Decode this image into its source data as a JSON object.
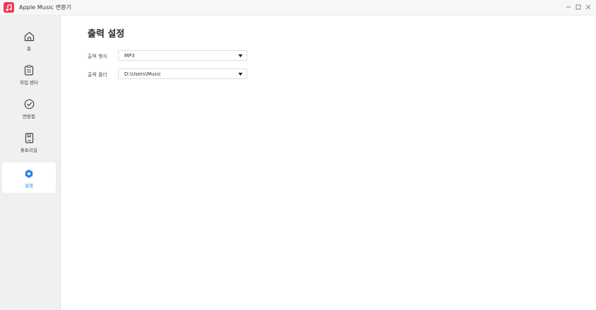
{
  "app": {
    "title": "Apple Music 변환기"
  },
  "sidebar": {
    "items": [
      {
        "label": "홈",
        "icon": "home-icon"
      },
      {
        "label": "작업 센터",
        "icon": "clipboard-icon"
      },
      {
        "label": "변환됨",
        "icon": "check-circle-icon"
      },
      {
        "label": "튜토리얼",
        "icon": "book-icon"
      },
      {
        "label": "설정",
        "icon": "gear-icon",
        "active": true
      }
    ]
  },
  "settings": {
    "title": "출력 설정",
    "output_format": {
      "label": "출력 형식",
      "value": "MP3"
    },
    "output_folder": {
      "label": "출력 폴더",
      "value": "D:\\Users\\Music"
    }
  },
  "colors": {
    "accent": "#2b83e6",
    "brand": "#ef3a4f"
  }
}
